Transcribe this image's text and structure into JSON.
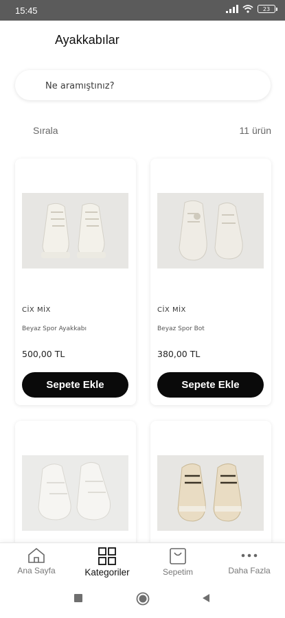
{
  "status_bar": {
    "time": "15:45",
    "battery": "23"
  },
  "header": {
    "title": "Ayakkabılar"
  },
  "search": {
    "placeholder": "Ne aramıştınız?"
  },
  "toolbar": {
    "sort_label": "Sırala",
    "result_count": "11 ürün"
  },
  "products": [
    {
      "brand": "CİX MİX",
      "name": "Beyaz Spor Ayakkabı",
      "price": "500,00 TL",
      "button": "Sepete Ekle"
    },
    {
      "brand": "CİX MİX",
      "name": "Beyaz Spor Bot",
      "price": "380,00 TL",
      "button": "Sepete Ekle"
    }
  ],
  "bottom_nav": {
    "items": [
      {
        "label": "Ana Sayfa",
        "icon": "home-icon"
      },
      {
        "label": "Kategoriler",
        "icon": "grid-icon",
        "active": true
      },
      {
        "label": "Sepetim",
        "icon": "bag-icon"
      },
      {
        "label": "Daha Fazla",
        "icon": "more-icon"
      }
    ]
  },
  "colors": {
    "primary_button": "#0a0a0a",
    "status_bar": "#5b5b5b"
  }
}
